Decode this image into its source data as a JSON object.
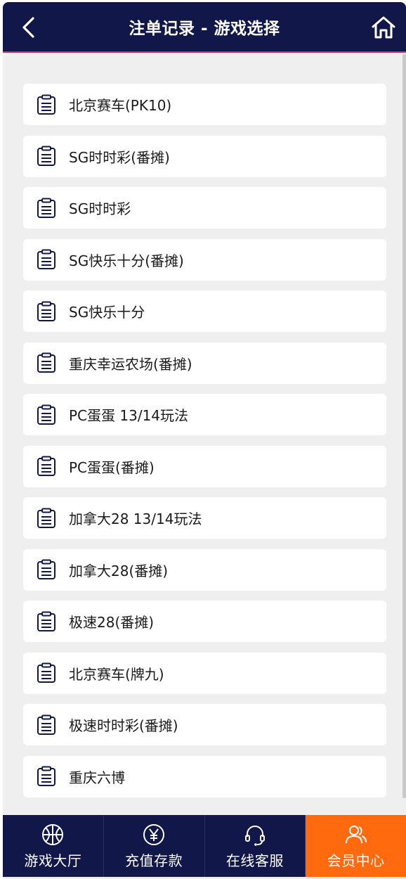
{
  "header": {
    "title": "注单记录 - 游戏选择",
    "back_icon": "chevron-left-icon",
    "home_icon": "home-icon"
  },
  "colors": {
    "header_bg": "#12174a",
    "header_accent": "#b5385a",
    "page_bg": "#efefef",
    "tab_active": "#ff6a0f",
    "icon_stroke": "#12174a"
  },
  "games": [
    {
      "label": "北京赛车(PK10)"
    },
    {
      "label": "SG时时彩(番摊)"
    },
    {
      "label": "SG时时彩"
    },
    {
      "label": "SG快乐十分(番摊)"
    },
    {
      "label": "SG快乐十分"
    },
    {
      "label": "重庆幸运农场(番摊)"
    },
    {
      "label": "PC蛋蛋 13/14玩法"
    },
    {
      "label": "PC蛋蛋(番摊)"
    },
    {
      "label": "加拿大28 13/14玩法"
    },
    {
      "label": "加拿大28(番摊)"
    },
    {
      "label": "极速28(番摊)"
    },
    {
      "label": "北京赛车(牌九)"
    },
    {
      "label": "极速时时彩(番摊)"
    },
    {
      "label": "重庆六博"
    }
  ],
  "tabbar": {
    "items": [
      {
        "label": "游戏大厅",
        "icon": "basketball-icon",
        "active": false
      },
      {
        "label": "充值存款",
        "icon": "yen-coin-icon",
        "active": false
      },
      {
        "label": "在线客服",
        "icon": "headset-icon",
        "active": false
      },
      {
        "label": "会员中心",
        "icon": "users-icon",
        "active": true
      }
    ]
  }
}
